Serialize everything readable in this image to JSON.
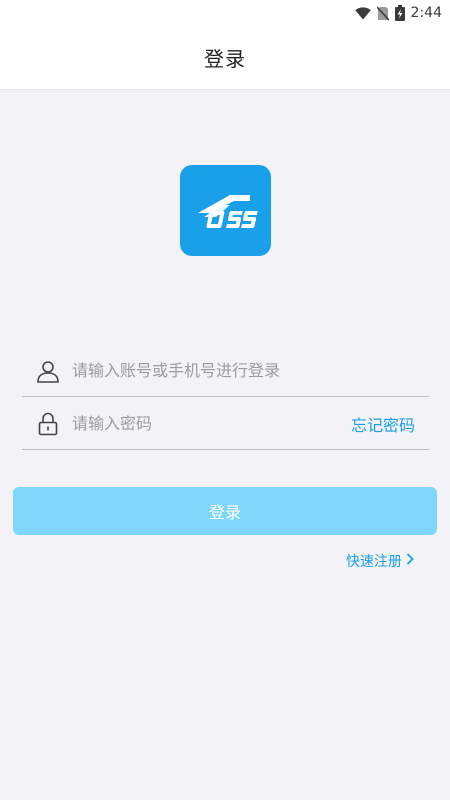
{
  "status_bar": {
    "time": "2:44",
    "icons": [
      "wifi-icon",
      "no-sim-icon",
      "battery-charging-icon"
    ]
  },
  "header": {
    "title": "登录"
  },
  "logo": {
    "text": "OSS",
    "icon": "app-logo-icon",
    "color": "#1aa0e8"
  },
  "form": {
    "account": {
      "placeholder": "请输入账号或手机号进行登录",
      "value": "",
      "icon": "user-icon"
    },
    "password": {
      "placeholder": "请输入密码",
      "value": "",
      "icon": "lock-icon"
    },
    "forgot_label": "忘记密码",
    "login_label": "登录",
    "register_label": "快速注册"
  },
  "colors": {
    "accent": "#1aa0e8",
    "button_disabled": "#7fd6fb",
    "background": "#f3f2f6"
  }
}
